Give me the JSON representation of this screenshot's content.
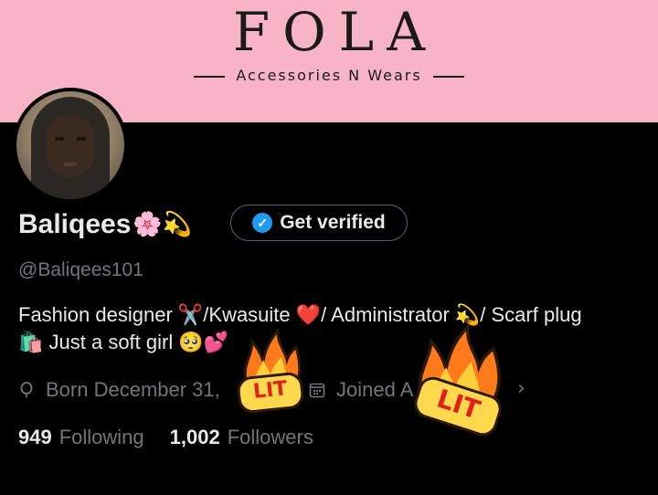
{
  "banner": {
    "brand": "FOLA",
    "tagline": "Accessories N Wears"
  },
  "profile": {
    "display_name": "Baliqees",
    "name_emojis": "🌸💫",
    "verify_button": "Get verified",
    "handle": "@Baliqees101",
    "bio_line1": "Fashion designer ✂️/Kwasuite ❤️/ Administrator 💫/  Scarf plug",
    "bio_line2": "🛍️ Just a soft girl 🥺💕",
    "born": "Born December 31,",
    "joined": "Joined A",
    "following_count": "949",
    "following_label": "Following",
    "followers_count": "1,002",
    "followers_label": "Followers"
  },
  "stickers": [
    {
      "text": "LIT"
    },
    {
      "text": "LIT"
    }
  ],
  "colors": {
    "banner": "#f6b4c4",
    "background": "#000000",
    "text": "#e7e9ea",
    "muted": "#71767b",
    "verify_blue": "#1d9bf0"
  }
}
